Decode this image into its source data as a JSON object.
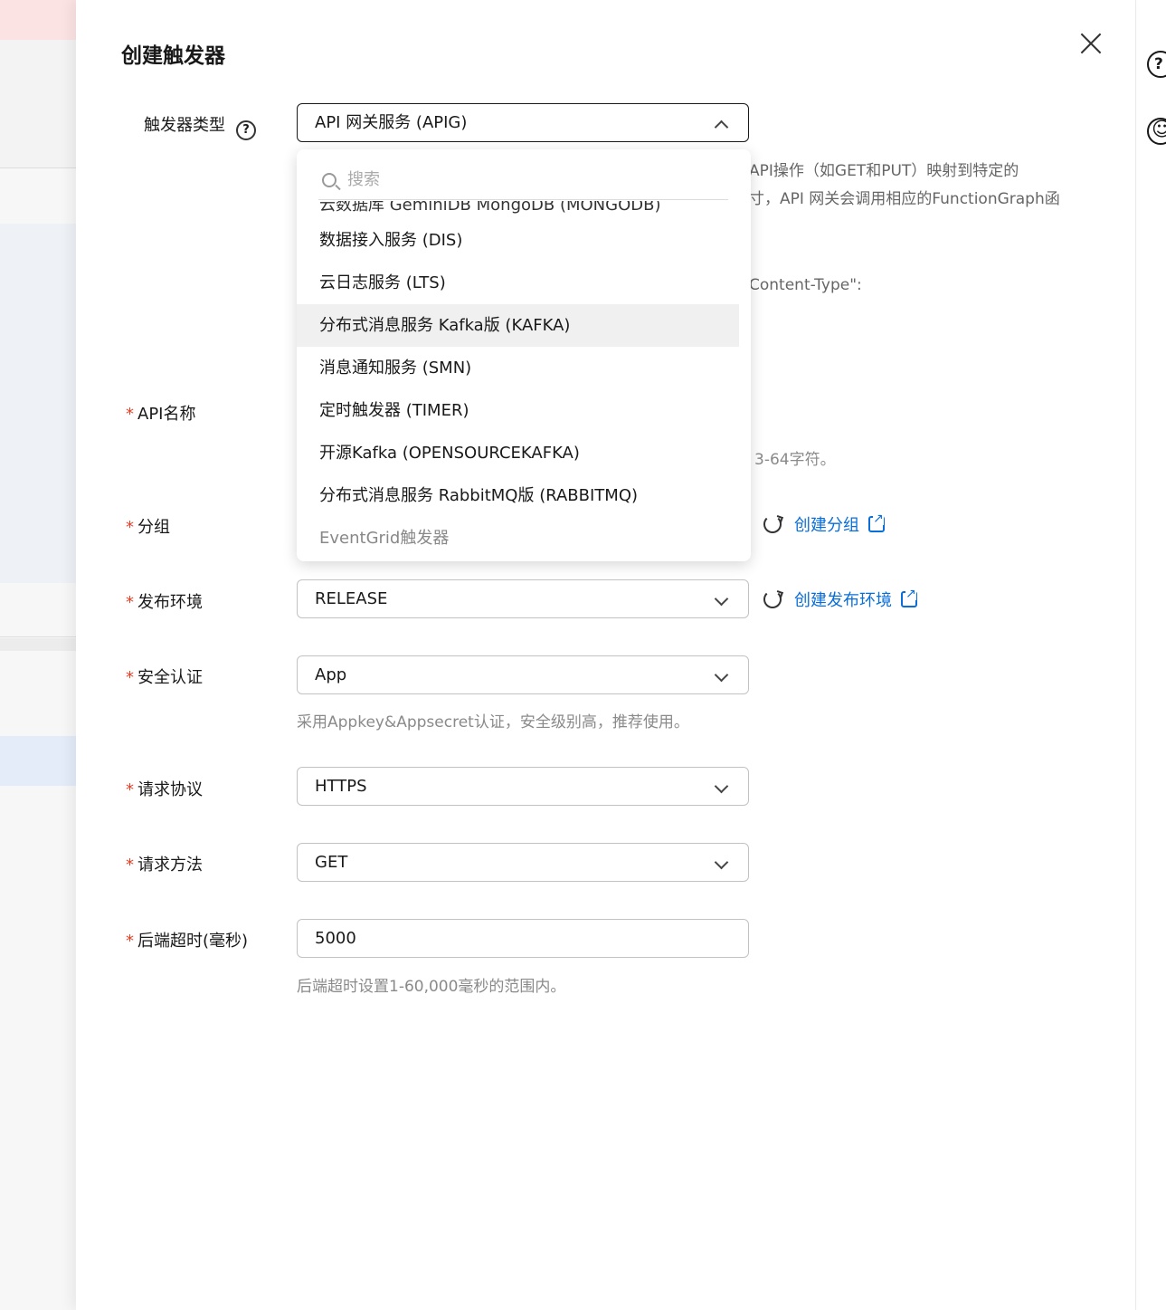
{
  "drawer": {
    "title": "创建触发器"
  },
  "trigger_type": {
    "label": "触发器类型",
    "value": "API 网关服务 (APIG)"
  },
  "description_behind": {
    "line1": "API操作（如GET和PUT）映射到特定的",
    "line2": "寸，API 网关会调用相应的FunctionGraph函",
    "line3": "Content-Type\":",
    "name_hint": "3-64字符。"
  },
  "dropdown": {
    "search_placeholder": "搜索",
    "options": [
      "云数据库 GeminiDB MongoDB (MONGODB)",
      "数据接入服务 (DIS)",
      "云日志服务 (LTS)",
      "分布式消息服务 Kafka版 (KAFKA)",
      "消息通知服务 (SMN)",
      "定时触发器 (TIMER)",
      "开源Kafka (OPENSOURCEKAFKA)",
      "分布式消息服务 RabbitMQ版 (RABBITMQ)"
    ],
    "group_label": "EventGrid触发器"
  },
  "fields": {
    "required_mark": "*",
    "api_name_label": "API名称",
    "group_label": "分组",
    "create_group_link": "创建分组",
    "env_label": "发布环境",
    "env_value": "RELEASE",
    "create_env_link": "创建发布环境",
    "auth_label": "安全认证",
    "auth_value": "App",
    "auth_hint": "采用Appkey&Appsecret认证，安全级别高，推荐使用。",
    "protocol_label": "请求协议",
    "protocol_value": "HTTPS",
    "method_label": "请求方法",
    "method_value": "GET",
    "timeout_label": "后端超时(毫秒)",
    "timeout_value": "5000",
    "timeout_hint": "后端超时设置1-60,000毫秒的范围内。"
  },
  "gutter": {
    "help_glyph": "?",
    "feedback_glyph": "☺"
  }
}
